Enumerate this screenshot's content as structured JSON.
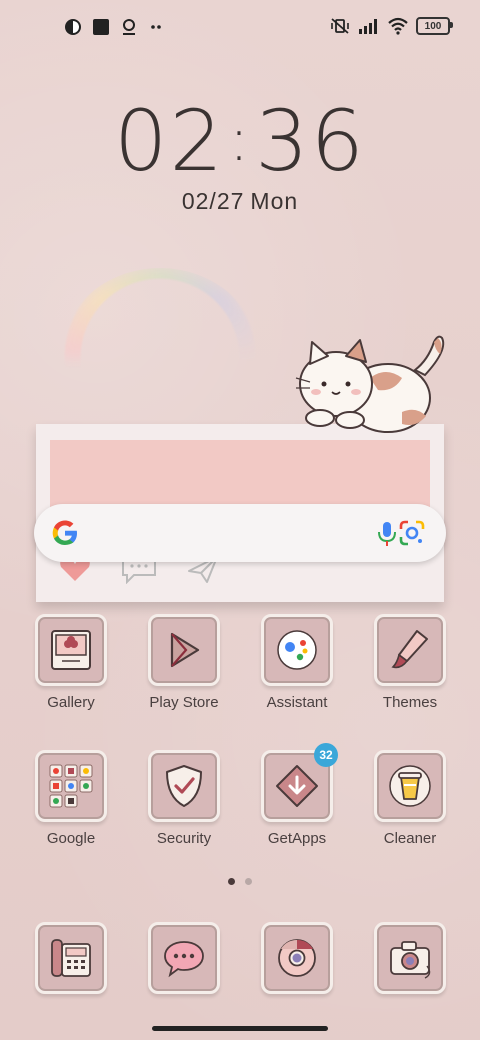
{
  "status_bar": {
    "battery": "100",
    "left_icons": [
      "app-notification-icon",
      "square-notification-icon",
      "location-pin-icon",
      "more-dots-icon"
    ],
    "right_icons": [
      "vibrate-off-icon",
      "signal-icon",
      "wifi-icon",
      "battery-icon"
    ]
  },
  "clock": {
    "hours": "02",
    "separator": ":",
    "minutes": "36"
  },
  "date": {
    "day": "02/27",
    "weekday": "Mon"
  },
  "apps": [
    {
      "label": "Gallery",
      "icon": "gallery-icon"
    },
    {
      "label": "Play Store",
      "icon": "play-store-icon"
    },
    {
      "label": "Assistant",
      "icon": "assistant-icon"
    },
    {
      "label": "Themes",
      "icon": "themes-icon"
    },
    {
      "label": "Google",
      "icon": "google-folder-icon"
    },
    {
      "label": "Security",
      "icon": "security-icon"
    },
    {
      "label": "GetApps",
      "icon": "getapps-icon",
      "badge": "32"
    },
    {
      "label": "Cleaner",
      "icon": "cleaner-icon"
    }
  ],
  "dock": [
    {
      "icon": "phone-icon"
    },
    {
      "icon": "messages-icon"
    },
    {
      "icon": "chrome-icon"
    },
    {
      "icon": "camera-icon"
    }
  ],
  "colors": {
    "accent_pink": "#f2c9c5",
    "icon_bg": "#d7b8b8",
    "badge": "#3aa7d9"
  }
}
